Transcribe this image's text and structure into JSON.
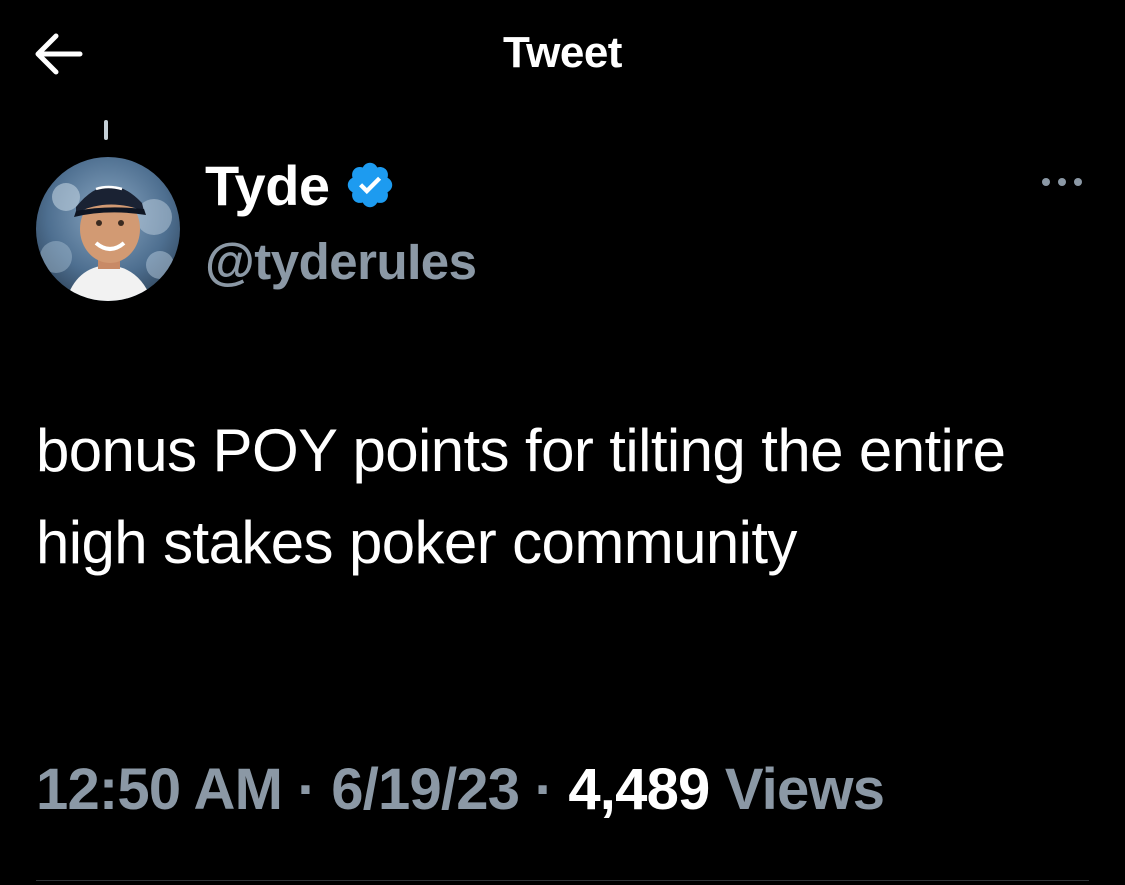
{
  "header": {
    "title": "Tweet",
    "back_icon": "arrow-left-icon"
  },
  "author": {
    "name": "Tyde",
    "handle": "@tyderuIes",
    "verified": true,
    "verified_color": "#1d9bf0",
    "avatar_icon": "profile-photo"
  },
  "more_icon": "ellipsis-icon",
  "tweet": {
    "text": "bonus POY points for tilting the entire high stakes poker community"
  },
  "meta": {
    "time": "12:50 AM",
    "sep1": " · ",
    "date": "6/19/23",
    "sep2": " · ",
    "views_count": "4,489",
    "views_label": " Views"
  },
  "colors": {
    "background": "#000000",
    "primary_text": "#ffffff",
    "secondary_text": "#8b98a5",
    "divider": "#2f3336"
  }
}
